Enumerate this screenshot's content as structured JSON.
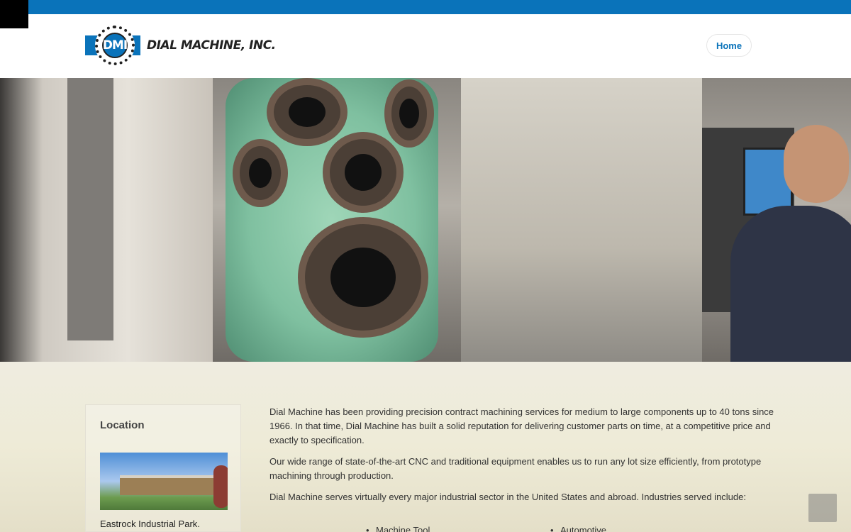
{
  "brand": {
    "logo_mark": "DMI",
    "logo_text": "DIAL MACHINE, INC."
  },
  "nav": {
    "home_label": "Home"
  },
  "sidebar": {
    "title": "Location",
    "caption": "Eastrock Industrial Park."
  },
  "main": {
    "paragraphs": [
      "Dial Machine has been providing precision contract machining services for medium to large components up to 40 tons since 1966. In that time, Dial Machine has built a solid reputation for delivering customer parts on time, at a competitive price and exactly to specification.",
      "Our wide range of state-of-the-art CNC and traditional equipment enables us to run any lot size efficiently, from prototype machining through production.",
      "Dial Machine serves virtually every major industrial sector in the United States and abroad. Industries served include:"
    ],
    "industries": [
      "Machine Tool",
      "Automotive"
    ]
  },
  "colors": {
    "brand_blue": "#0a73ba",
    "content_bg": "#efece0"
  },
  "icons": {
    "back_to_top": "chevron-up-icon"
  }
}
